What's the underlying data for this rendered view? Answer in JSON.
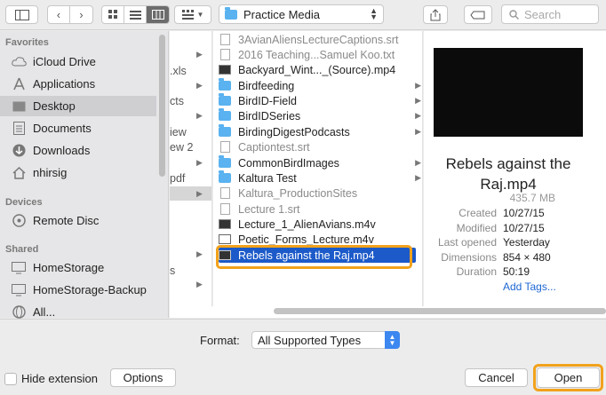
{
  "toolbar": {
    "location": "Practice Media",
    "search_placeholder": "Search"
  },
  "sidebar": {
    "sections": [
      {
        "heading": "Favorites",
        "items": [
          {
            "label": "iCloud Drive",
            "icon": "cloud-icon"
          },
          {
            "label": "Applications",
            "icon": "applications-icon"
          },
          {
            "label": "Desktop",
            "icon": "desktop-icon",
            "selected": true
          },
          {
            "label": "Documents",
            "icon": "documents-icon"
          },
          {
            "label": "Downloads",
            "icon": "downloads-icon"
          },
          {
            "label": "nhirsig",
            "icon": "home-icon"
          }
        ]
      },
      {
        "heading": "Devices",
        "items": [
          {
            "label": "Remote Disc",
            "icon": "disc-icon"
          }
        ]
      },
      {
        "heading": "Shared",
        "items": [
          {
            "label": "HomeStorage",
            "icon": "monitor-icon"
          },
          {
            "label": "HomeStorage-Backup",
            "icon": "monitor-icon"
          },
          {
            "label": "All...",
            "icon": "globe-icon"
          }
        ]
      }
    ]
  },
  "prev_column": [
    ".xls",
    "cts",
    "iew",
    "ew 2",
    "pdf",
    "s"
  ],
  "files": [
    {
      "name": "3AvianAliensLectureCaptions.srt",
      "type": "doc",
      "dim": true
    },
    {
      "name": "2016 Teaching...Samuel Koo.txt",
      "type": "doc",
      "dim": true
    },
    {
      "name": "Backyard_Wint..._(Source).mp4",
      "type": "video"
    },
    {
      "name": "Birdfeeding",
      "type": "folder",
      "folder": true
    },
    {
      "name": "BirdID-Field",
      "type": "folder",
      "folder": true
    },
    {
      "name": "BirdIDSeries",
      "type": "folder",
      "folder": true
    },
    {
      "name": "BirdingDigestPodcasts",
      "type": "folder",
      "folder": true
    },
    {
      "name": "Captiontest.srt",
      "type": "doc",
      "dim": true
    },
    {
      "name": "CommonBirdImages",
      "type": "folder",
      "folder": true
    },
    {
      "name": "Kaltura Test",
      "type": "folder",
      "folder": true
    },
    {
      "name": "Kaltura_ProductionSites",
      "type": "doc",
      "dim": true
    },
    {
      "name": "Lecture 1.srt",
      "type": "doc",
      "dim": true
    },
    {
      "name": "Lecture_1_AlienAvians.m4v",
      "type": "video"
    },
    {
      "name": "Poetic_Forms_Lecture.m4v",
      "type": "poet"
    },
    {
      "name": "Rebels against the Raj.mp4",
      "type": "video",
      "selected": true
    }
  ],
  "preview": {
    "title": "Rebels against the Raj.mp4",
    "size": "435.7 MB",
    "meta": [
      {
        "key": "Created",
        "value": "10/27/15"
      },
      {
        "key": "Modified",
        "value": "10/27/15"
      },
      {
        "key": "Last opened",
        "value": "Yesterday"
      },
      {
        "key": "Dimensions",
        "value": "854 × 480"
      },
      {
        "key": "Duration",
        "value": "50:19"
      }
    ],
    "add_tags": "Add Tags..."
  },
  "bottom": {
    "format_label": "Format:",
    "format_value": "All Supported Types",
    "hide_extension_label": "Hide extension",
    "options_label": "Options",
    "cancel_label": "Cancel",
    "open_label": "Open"
  },
  "colors": {
    "selection": "#1c5ac9",
    "highlight": "#f2a21c",
    "folder": "#5ab2f0"
  }
}
